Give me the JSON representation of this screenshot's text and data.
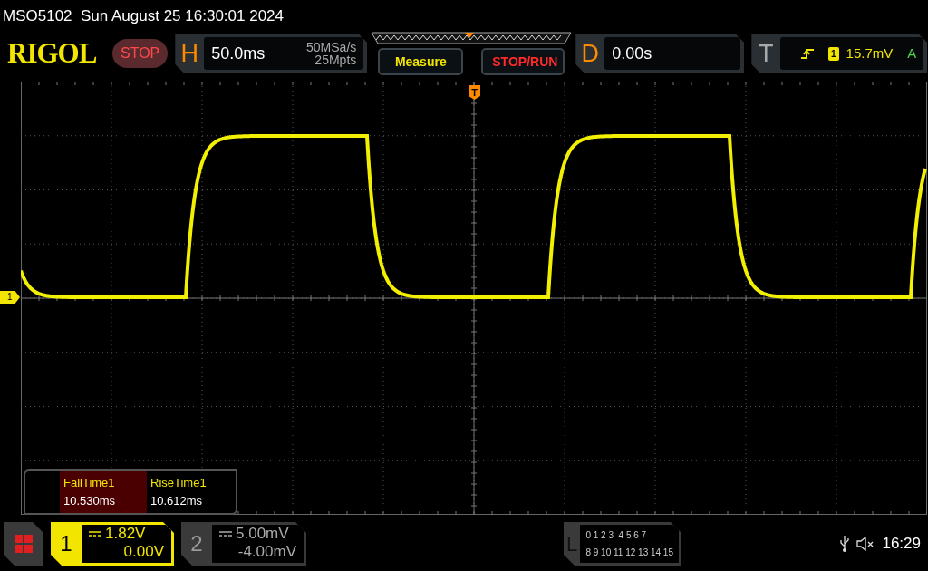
{
  "title_bar": {
    "text": "MSO5102  Sun August 25 16:30:01 2024"
  },
  "header": {
    "logo": "RIGOL",
    "run_status": "STOP",
    "horizontal": {
      "letter": "H",
      "timebase": "50.0ms",
      "sample_rate": "50MSa/s",
      "memory_depth": "25Mpts"
    },
    "buttons": [
      {
        "label": "Measure",
        "kind": "measure"
      },
      {
        "label": "STOP/RUN",
        "kind": "stoprun"
      }
    ],
    "delay": {
      "letter": "D",
      "value": "0.00s"
    },
    "trigger": {
      "letter": "T",
      "source": "1",
      "level": "15.7mV",
      "mode": "A"
    }
  },
  "display": {
    "trigger_marker": "T",
    "channel_marker": "1",
    "measurements": [
      {
        "name": "FallTime1",
        "value": "10.530ms",
        "selected": true
      },
      {
        "name": "RiseTime1",
        "value": "10.612ms",
        "selected": false
      }
    ]
  },
  "channels": [
    {
      "number": "1",
      "scale": "1.82V",
      "offset": "0.00V",
      "active": true
    },
    {
      "number": "2",
      "scale": "5.00mV",
      "offset": "-4.00mV",
      "active": false
    }
  ],
  "logic": {
    "letter": "L",
    "rows": [
      "0 1 2 3  4 5 6 7",
      "8 9 10 11 12 13 14 15"
    ]
  },
  "status": {
    "time": "16:29"
  }
}
